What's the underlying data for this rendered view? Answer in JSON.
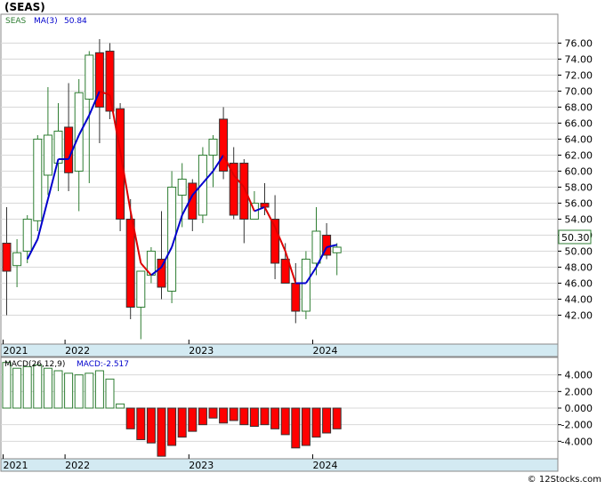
{
  "header": {
    "title": "(SEAS)"
  },
  "watermark": "© 12Stocks.com",
  "colors": {
    "up_candle": "#2e7d32",
    "down_candle": "#ff0000",
    "ma_up": "#0000cc",
    "ma_down": "#dd0000",
    "macd_pos": "#2e7d32",
    "macd_neg": "#ff0000",
    "axis_band": "#d3eaf2",
    "grid": "#d8d8d8"
  },
  "chart_data": [
    {
      "type": "candlestick",
      "legend": [
        {
          "name": "SEAS",
          "value": ""
        },
        {
          "name": "MA(3)",
          "value": "50.84"
        }
      ],
      "last_price_label": "50.30",
      "ylim": [
        38.5,
        79.5
      ],
      "y_ticks": [
        42,
        44,
        46,
        48,
        50,
        52,
        54,
        56,
        58,
        60,
        62,
        64,
        66,
        68,
        70,
        72,
        74,
        76
      ],
      "y_tick_labels": [
        "42.00",
        "44.00",
        "46.00",
        "48.00",
        "50.00",
        "52.00",
        "54.00",
        "56.00",
        "58.00",
        "60.00",
        "62.00",
        "64.00",
        "66.00",
        "68.00",
        "70.00",
        "72.00",
        "74.00",
        "76.00"
      ],
      "x_axis_labels": [
        {
          "label": "2021",
          "index": 0
        },
        {
          "label": "2022",
          "index": 6
        },
        {
          "label": "2023",
          "index": 18
        },
        {
          "label": "2024",
          "index": 30
        }
      ],
      "candles": [
        {
          "date": "2021-01",
          "open": 51.0,
          "high": 55.5,
          "low": 42.0,
          "close": 47.5
        },
        {
          "date": "2021-02",
          "open": 48.2,
          "high": 51.5,
          "low": 45.5,
          "close": 49.8
        },
        {
          "date": "2021-03",
          "open": 50.0,
          "high": 54.5,
          "low": 48.5,
          "close": 54.0
        },
        {
          "date": "2021-04",
          "open": 53.8,
          "high": 64.5,
          "low": 52.5,
          "close": 64.0
        },
        {
          "date": "2021-05",
          "open": 59.5,
          "high": 70.5,
          "low": 57.0,
          "close": 64.5
        },
        {
          "date": "2021-06",
          "open": 61.0,
          "high": 68.5,
          "low": 57.5,
          "close": 65.0
        },
        {
          "date": "2021-07",
          "open": 65.5,
          "high": 71.0,
          "low": 57.5,
          "close": 59.8
        },
        {
          "date": "2021-08",
          "open": 60.0,
          "high": 71.5,
          "low": 55.0,
          "close": 69.8
        },
        {
          "date": "2021-09",
          "open": 69.0,
          "high": 75.0,
          "low": 58.5,
          "close": 74.5
        },
        {
          "date": "2021-10",
          "open": 74.8,
          "high": 76.5,
          "low": 63.5,
          "close": 68.0
        },
        {
          "date": "2021-11",
          "open": 75.0,
          "high": 76.0,
          "low": 66.5,
          "close": 67.5
        },
        {
          "date": "2021-12",
          "open": 67.8,
          "high": 68.5,
          "low": 52.5,
          "close": 54.0
        },
        {
          "date": "2022-01",
          "open": 54.0,
          "high": 56.5,
          "low": 41.5,
          "close": 43.0
        },
        {
          "date": "2022-02",
          "open": 43.0,
          "high": 47.5,
          "low": 39.0,
          "close": 47.5
        },
        {
          "date": "2022-03",
          "open": 47.0,
          "high": 50.5,
          "low": 46.0,
          "close": 50.0
        },
        {
          "date": "2022-04",
          "open": 49.0,
          "high": 55.0,
          "low": 44.0,
          "close": 45.5
        },
        {
          "date": "2022-05",
          "open": 45.0,
          "high": 60.0,
          "low": 43.5,
          "close": 58.0
        },
        {
          "date": "2022-06",
          "open": 57.0,
          "high": 61.0,
          "low": 53.0,
          "close": 59.0
        },
        {
          "date": "2022-07",
          "open": 58.5,
          "high": 59.0,
          "low": 52.5,
          "close": 54.0
        },
        {
          "date": "2022-08",
          "open": 54.5,
          "high": 63.0,
          "low": 53.5,
          "close": 62.0
        },
        {
          "date": "2022-09",
          "open": 62.0,
          "high": 64.5,
          "low": 58.0,
          "close": 64.0
        },
        {
          "date": "2022-10",
          "open": 66.5,
          "high": 68.0,
          "low": 59.0,
          "close": 60.0
        },
        {
          "date": "2022-11",
          "open": 61.0,
          "high": 63.0,
          "low": 54.0,
          "close": 54.5
        },
        {
          "date": "2022-12",
          "open": 61.0,
          "high": 61.5,
          "low": 51.0,
          "close": 54.0
        },
        {
          "date": "2023-01",
          "open": 54.0,
          "high": 57.5,
          "low": 54.0,
          "close": 56.0
        },
        {
          "date": "2023-02",
          "open": 56.0,
          "high": 58.5,
          "low": 54.5,
          "close": 55.5
        },
        {
          "date": "2023-03",
          "open": 54.0,
          "high": 57.0,
          "low": 46.5,
          "close": 48.5
        },
        {
          "date": "2023-04",
          "open": 49.0,
          "high": 51.0,
          "low": 46.5,
          "close": 46.0
        },
        {
          "date": "2023-05",
          "open": 46.0,
          "high": 48.5,
          "low": 41.0,
          "close": 42.5
        },
        {
          "date": "2023-06",
          "open": 42.5,
          "high": 50.0,
          "low": 41.5,
          "close": 49.0
        },
        {
          "date": "2023-07",
          "open": 48.5,
          "high": 55.5,
          "low": 47.0,
          "close": 52.5
        },
        {
          "date": "2023-08",
          "open": 52.0,
          "high": 53.5,
          "low": 49.0,
          "close": 49.5
        },
        {
          "date": "2023-09",
          "open": 49.8,
          "high": 51.0,
          "low": 47.0,
          "close": 50.5
        }
      ],
      "ma3": [
        null,
        null,
        49.0,
        51.5,
        56.5,
        61.5,
        61.5,
        64.5,
        67.0,
        70.0,
        69.5,
        62.5,
        55.0,
        48.5,
        47.0,
        48.0,
        50.5,
        54.5,
        57.0,
        58.5,
        60.0,
        62.0,
        59.5,
        58.0,
        55.0,
        55.5,
        53.0,
        50.0,
        46.0,
        46.0,
        48.0,
        50.5,
        50.8
      ]
    },
    {
      "type": "bar",
      "legend": [
        {
          "name": "MACD(26,12,9)",
          "value": ""
        },
        {
          "name": "MACD:",
          "value": "-2.517"
        }
      ],
      "ylim": [
        -6.0,
        6.0
      ],
      "y_ticks": [
        -4,
        -2,
        0,
        2,
        4
      ],
      "y_tick_labels": [
        "-4.000",
        "-2.000",
        "0.000",
        "2.000",
        "4.000"
      ],
      "x_axis_labels": [
        {
          "label": "2021",
          "index": 0
        },
        {
          "label": "2022",
          "index": 6
        },
        {
          "label": "2023",
          "index": 18
        },
        {
          "label": "2024",
          "index": 30
        }
      ],
      "values": [
        5.5,
        4.8,
        5.0,
        5.2,
        4.8,
        4.5,
        4.2,
        4.0,
        4.2,
        4.5,
        3.5,
        0.5,
        -2.5,
        -3.8,
        -4.2,
        -5.8,
        -4.5,
        -3.5,
        -2.8,
        -2.0,
        -1.2,
        -1.8,
        -1.5,
        -2.0,
        -2.2,
        -2.0,
        -2.5,
        -3.2,
        -4.8,
        -4.5,
        -3.5,
        -3.0,
        -2.5
      ]
    }
  ]
}
